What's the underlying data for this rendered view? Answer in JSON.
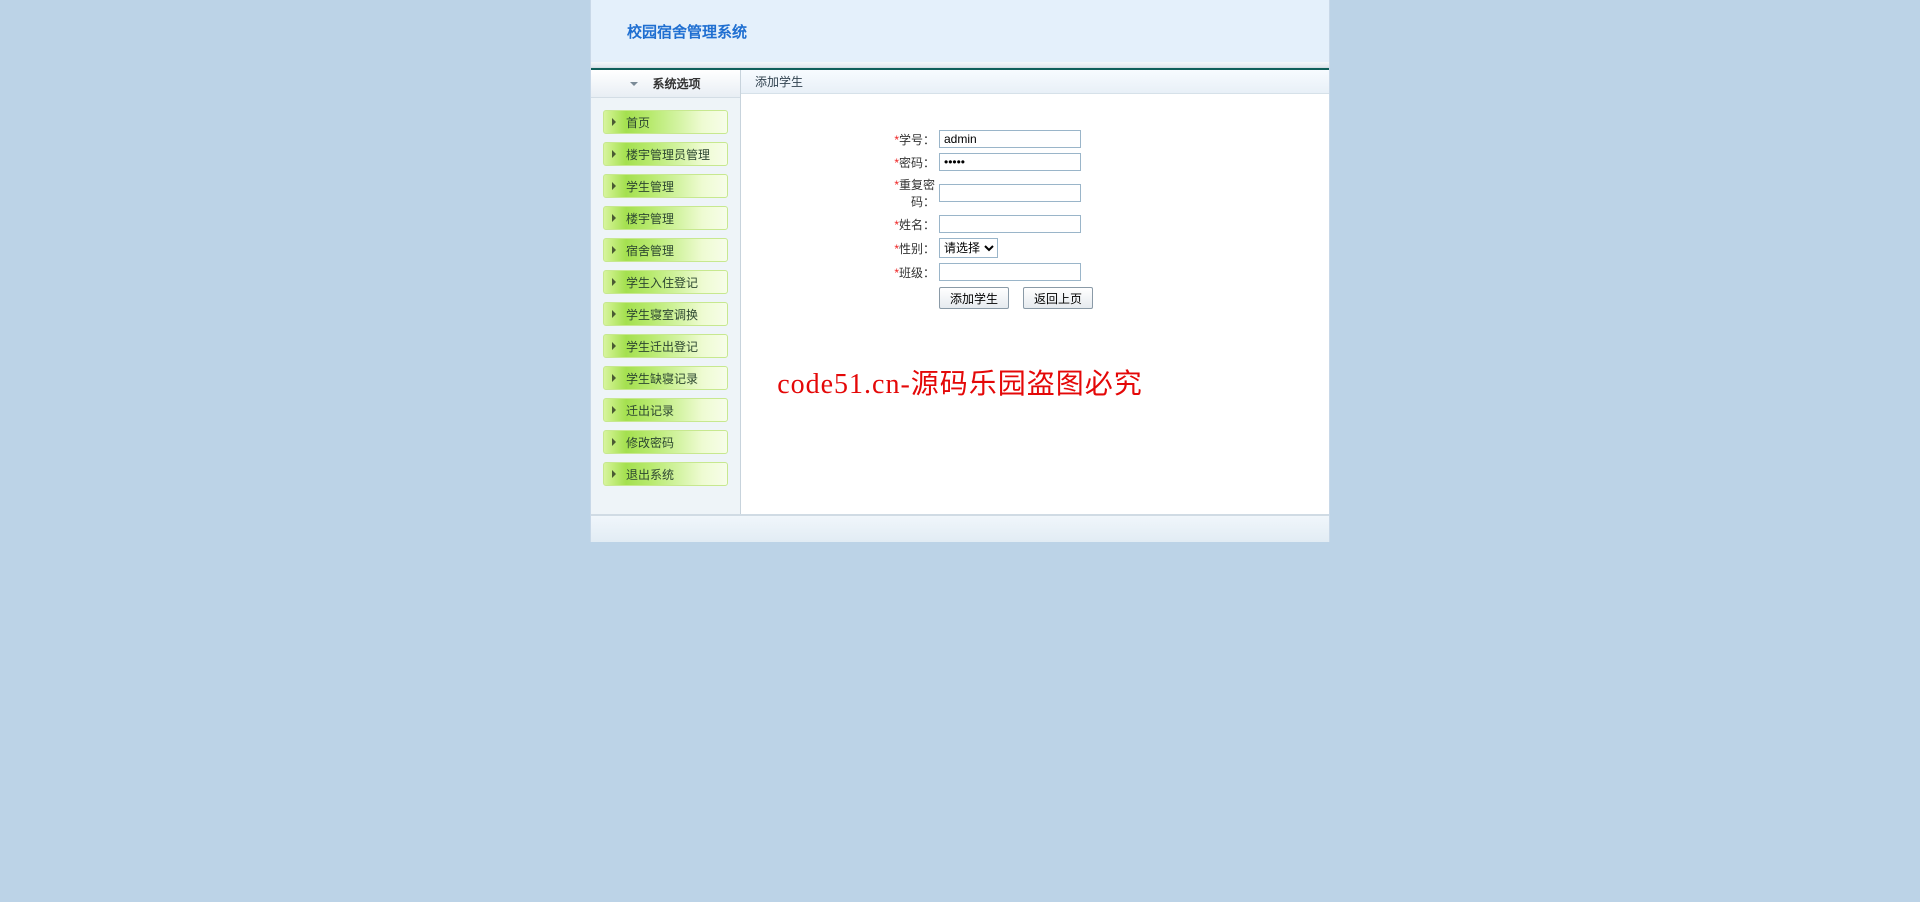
{
  "header": {
    "title": "校园宿舍管理系统"
  },
  "sidebar": {
    "header": "系统选项",
    "items": [
      {
        "label": "首页"
      },
      {
        "label": "楼宇管理员管理"
      },
      {
        "label": "学生管理"
      },
      {
        "label": "楼宇管理"
      },
      {
        "label": "宿舍管理"
      },
      {
        "label": "学生入住登记"
      },
      {
        "label": "学生寝室调换"
      },
      {
        "label": "学生迁出登记"
      },
      {
        "label": "学生缺寝记录"
      },
      {
        "label": "迁出记录"
      },
      {
        "label": "修改密码"
      },
      {
        "label": "退出系统"
      }
    ]
  },
  "main": {
    "panel_title": "添加学生",
    "form": {
      "student_number_label": "学号：",
      "student_number_value": "admin",
      "password_label": "密码：",
      "password_value": "•••••",
      "repeat_password_label": "重复密码：",
      "repeat_password_value": "",
      "name_label": "姓名：",
      "name_value": "",
      "gender_label": "性别：",
      "gender_selected": "请选择",
      "class_label": "班级：",
      "class_value": "",
      "submit_label": "添加学生",
      "back_label": "返回上页"
    }
  },
  "watermark": "code51.cn-源码乐园盗图必究"
}
